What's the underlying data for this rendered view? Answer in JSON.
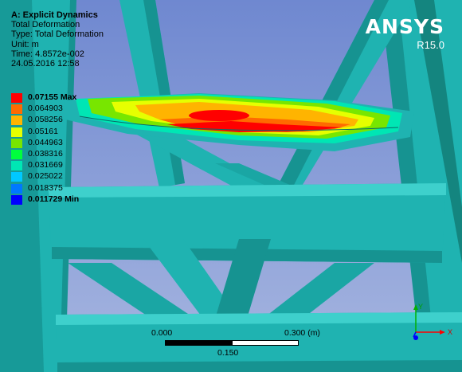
{
  "header": {
    "title": "A: Explicit Dynamics",
    "result_name": "Total Deformation",
    "type_line": "Type: Total Deformation",
    "unit_line": "Unit: m",
    "time_line": "Time: 4.8572e-002",
    "date_line": "24.05.2016 12:58"
  },
  "legend": {
    "items": [
      {
        "label": "0.07155 Max",
        "color": "#ff0000"
      },
      {
        "label": "0.064903",
        "color": "#ff6a00"
      },
      {
        "label": "0.058256",
        "color": "#ffb400"
      },
      {
        "label": "0.05161",
        "color": "#e6ff00"
      },
      {
        "label": "0.044963",
        "color": "#78e600"
      },
      {
        "label": "0.038316",
        "color": "#00ff3c"
      },
      {
        "label": "0.031669",
        "color": "#00e6b4"
      },
      {
        "label": "0.025022",
        "color": "#00c8ff"
      },
      {
        "label": "0.018375",
        "color": "#0078ff"
      },
      {
        "label": "0.011729 Min",
        "color": "#0000ff"
      }
    ]
  },
  "logo": {
    "name": "ANSYS",
    "version": "R15.0"
  },
  "scale_bar": {
    "start": "0.000",
    "end": "0.300 (m)",
    "mid": "0.150"
  },
  "triad": {
    "y_label": "Y",
    "x_label": "X"
  },
  "colors": {
    "background": "#7f9ad6",
    "structure": "#1fb3b1",
    "structure_dark": "#169391",
    "structure_light": "#3ed0cc"
  }
}
